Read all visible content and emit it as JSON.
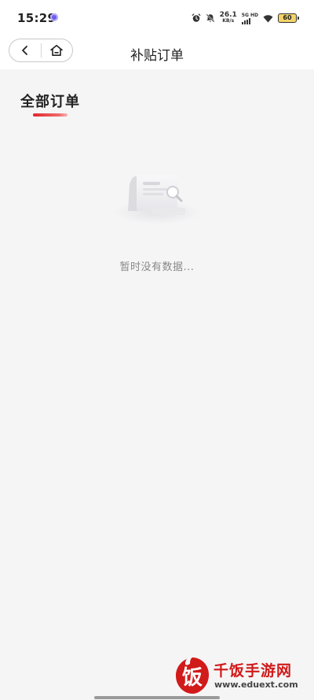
{
  "status_bar": {
    "time": "15:29",
    "app_indicator_icon": "app-notification-icon",
    "icons": [
      "alarm-icon",
      "do-not-disturb-icon"
    ],
    "network_speed_value": "26.1",
    "network_speed_unit": "KB/s",
    "network_label": "5G HD",
    "wifi_icon": "wifi-icon",
    "battery_level": "60"
  },
  "nav": {
    "title": "补贴订单",
    "back_icon": "back-arrow-icon",
    "home_icon": "home-icon"
  },
  "tabs": [
    {
      "label": "全部订单",
      "active": true
    }
  ],
  "empty_state": {
    "illustration_icon": "empty-document-search-icon",
    "message": "暂时没有数据..."
  },
  "watermark": {
    "logo_char": "饭",
    "name": "千饭手游网",
    "url": "www.eduext.com"
  },
  "colors": {
    "accent": "#e0282e",
    "background": "#f5f5f6",
    "header_background": "#ffffff",
    "watermark_red": "#d11a1a"
  }
}
